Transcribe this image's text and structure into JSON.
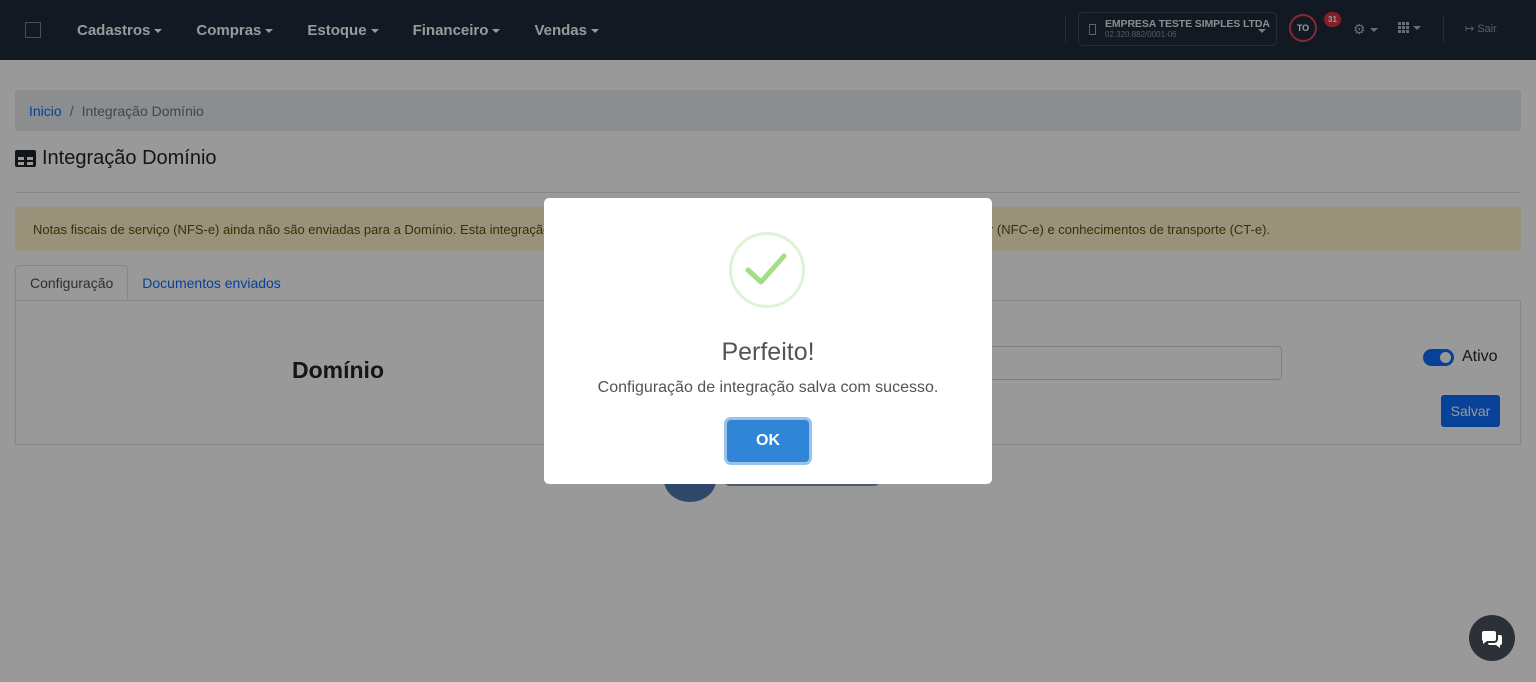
{
  "navbar": {
    "menu": [
      {
        "label": "Cadastros"
      },
      {
        "label": "Compras"
      },
      {
        "label": "Estoque"
      },
      {
        "label": "Financeiro"
      },
      {
        "label": "Vendas"
      }
    ],
    "company": {
      "name": "EMPRESA TESTE SIMPLES LTDA",
      "cnpj": "02.320.882/0001-06"
    },
    "avatar_initials": "TO",
    "notification_count": "31",
    "logout_label": "Sair"
  },
  "breadcrumb": {
    "home": "Inicio",
    "current": "Integração Domínio"
  },
  "page": {
    "title": "Integração Domínio",
    "alert_text": "Notas fiscais de serviço (NFS-e) ainda não são enviadas para a Domínio. Esta integração enviará apenas notas fiscais eletrônicas (NF-e), notas fiscais de consumidor (NFC-e) e conhecimentos de transporte (CT-e).",
    "tabs": [
      {
        "label": "Configuração",
        "active": true
      },
      {
        "label": "Documentos enviados",
        "active": false
      }
    ],
    "integration_name": "Domínio",
    "input_value": "",
    "toggle_label": "Ativo",
    "toggle_on": true,
    "save_label": "Salvar"
  },
  "modal": {
    "title": "Perfeito!",
    "text": "Configuração de integração salva com sucesso.",
    "ok_label": "OK"
  },
  "colors": {
    "navbar": "#1e2a3b",
    "primary": "#0d6efd",
    "alert_bg": "#fff3cd",
    "success": "#a5dc86",
    "modal_button": "#3085d6"
  }
}
